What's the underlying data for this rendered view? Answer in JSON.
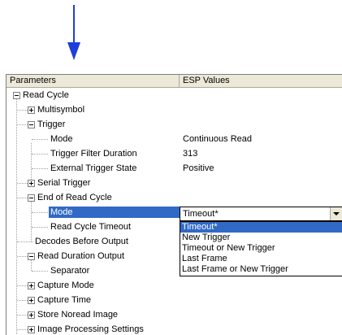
{
  "header": {
    "parameters": "Parameters",
    "esp_values": "ESP Values"
  },
  "tree": {
    "read_cycle": "Read Cycle",
    "multisymbol": "Multisymbol",
    "trigger": "Trigger",
    "mode": {
      "label": "Mode",
      "value": "Continuous Read"
    },
    "trigger_filter_duration": {
      "label": "Trigger Filter Duration",
      "value": "313"
    },
    "external_trigger_state": {
      "label": "External Trigger State",
      "value": "Positive"
    },
    "serial_trigger": "Serial Trigger",
    "end_of_read_cycle": "End of Read Cycle",
    "eorc_mode": {
      "label": "Mode",
      "value": "Timeout*"
    },
    "read_cycle_timeout": "Read Cycle Timeout",
    "decodes_before_output": "Decodes Before Output",
    "read_duration_output": "Read Duration Output",
    "separator": "Separator",
    "capture_mode": "Capture Mode",
    "capture_time": "Capture Time",
    "store_noread_image": "Store Noread Image",
    "image_processing_settings": "Image Processing Settings"
  },
  "dropdown_options": [
    "Timeout*",
    "New Trigger",
    "Timeout or New Trigger",
    "Last Frame",
    "Last Frame or New Trigger"
  ],
  "colors": {
    "arrow": "#1f3fd9",
    "selection": "#316ac5",
    "header_bg": "#ece9d8"
  }
}
